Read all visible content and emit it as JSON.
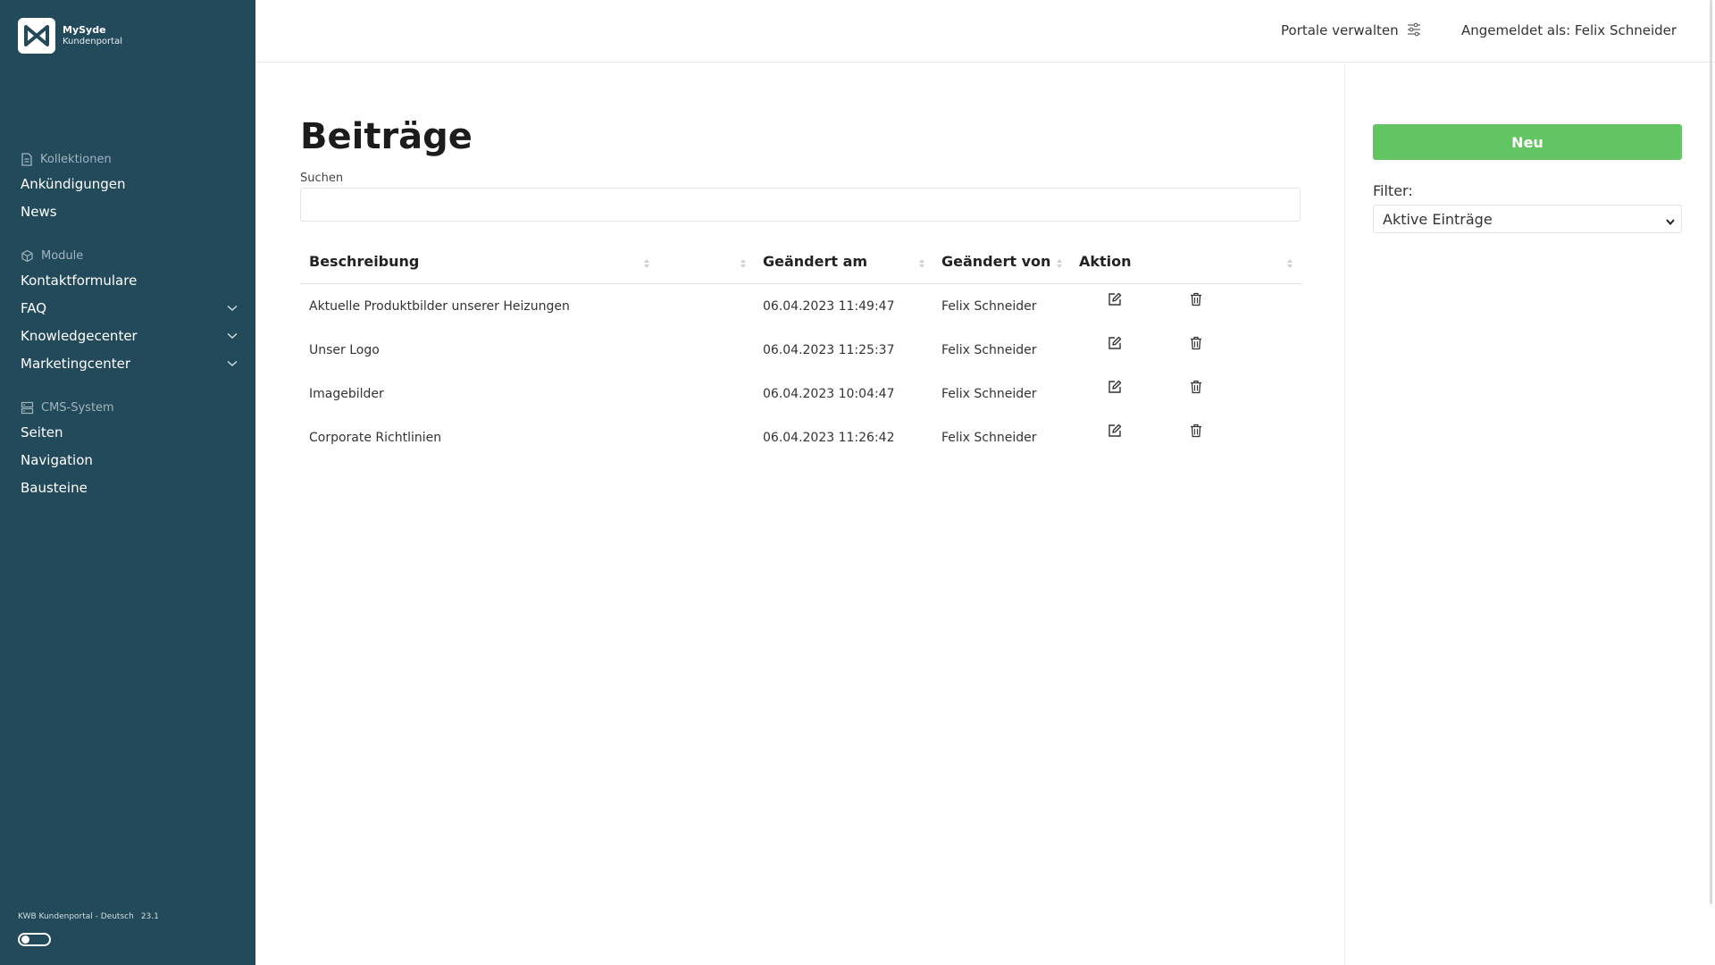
{
  "app": {
    "name": "MySyde",
    "subtitle": "Kundenportal"
  },
  "sidebar": {
    "sections": [
      {
        "label": "Kollektionen",
        "icon": "document-icon",
        "items": [
          {
            "label": "Ankündigungen"
          },
          {
            "label": "News"
          }
        ]
      },
      {
        "label": "Module",
        "icon": "cube-icon",
        "items": [
          {
            "label": "Kontaktformulare"
          },
          {
            "label": "FAQ",
            "expandable": true
          },
          {
            "label": "Knowledgecenter",
            "expandable": true
          },
          {
            "label": "Marketingcenter",
            "expandable": true
          }
        ]
      },
      {
        "label": "CMS-System",
        "icon": "server-icon",
        "items": [
          {
            "label": "Seiten"
          },
          {
            "label": "Navigation"
          },
          {
            "label": "Bausteine"
          }
        ]
      }
    ],
    "footer": {
      "portal": "KWB Kundenportal - Deutsch",
      "version": "23.1",
      "theme_toggle": "off"
    }
  },
  "header": {
    "manage_portals": "Portale verwalten",
    "user": "Angemeldet als: Felix Schneider"
  },
  "main": {
    "title": "Beiträge",
    "search_label": "Suchen",
    "search_value": "",
    "table": {
      "columns": [
        "Beschreibung",
        "",
        "Geändert am",
        "Geändert von",
        "Aktion"
      ],
      "rows": [
        {
          "description": "Aktuelle Produktbilder unserer Heizungen",
          "changed_at": "06.04.2023 11:49:47",
          "changed_by": "Felix Schneider"
        },
        {
          "description": "Unser Logo",
          "changed_at": "06.04.2023 11:25:37",
          "changed_by": "Felix Schneider"
        },
        {
          "description": "Imagebilder",
          "changed_at": "06.04.2023 10:04:47",
          "changed_by": "Felix Schneider"
        },
        {
          "description": "Corporate Richtlinien",
          "changed_at": "06.04.2023 11:26:42",
          "changed_by": "Felix Schneider"
        }
      ]
    }
  },
  "panel": {
    "new_button": "Neu",
    "filter_label": "Filter:",
    "filter_value": "Aktive Einträge"
  },
  "colors": {
    "sidebar": "#234a5b",
    "accent_green": "#62c462",
    "section_muted": "#9fb5bf"
  }
}
